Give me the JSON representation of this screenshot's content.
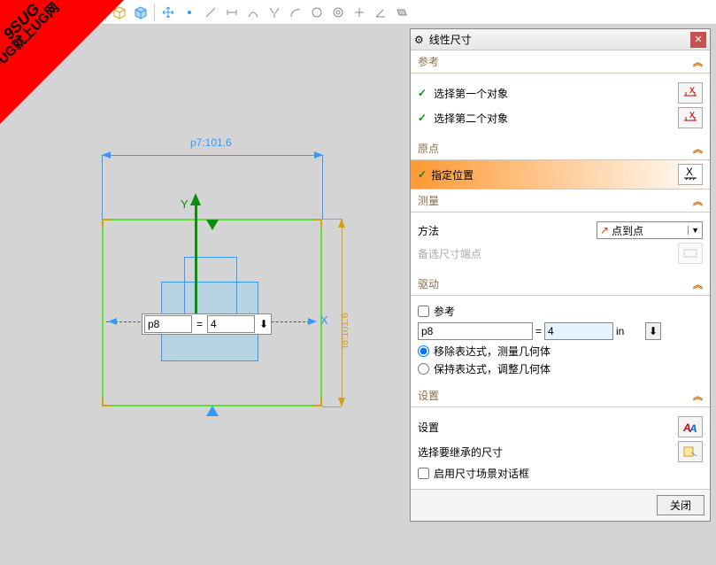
{
  "watermark": {
    "line1": "9SUG",
    "line2": "学UG就上UG网"
  },
  "sketch": {
    "dim_h_label": "p7:101.6",
    "dim_v_label": "t8:101.6",
    "y_label": "Y",
    "x_label": "X",
    "input_name": "p8",
    "input_eq": "=",
    "input_val": "4"
  },
  "dialog": {
    "title": "线性尺寸",
    "sections": {
      "ref": "参考",
      "sel1": "选择第一个对象",
      "sel2": "选择第二个对象",
      "origin": "原点",
      "origin_pos": "指定位置",
      "measure": "测量",
      "method_label": "方法",
      "method_value": "点到点",
      "alt_points": "备选尺寸端点",
      "drive": "驱动",
      "drive_ref": "参考",
      "drive_name": "p8",
      "drive_eq": "=",
      "drive_val": "4",
      "drive_unit": "in",
      "radio1": "移除表达式，测量几何体",
      "radio2": "保持表达式，调整几何体",
      "settings": "设置",
      "settings_item": "设置",
      "inherit": "选择要继承的尺寸",
      "scene_chk": "启用尺寸场景对话框"
    },
    "close_btn": "关闭"
  }
}
